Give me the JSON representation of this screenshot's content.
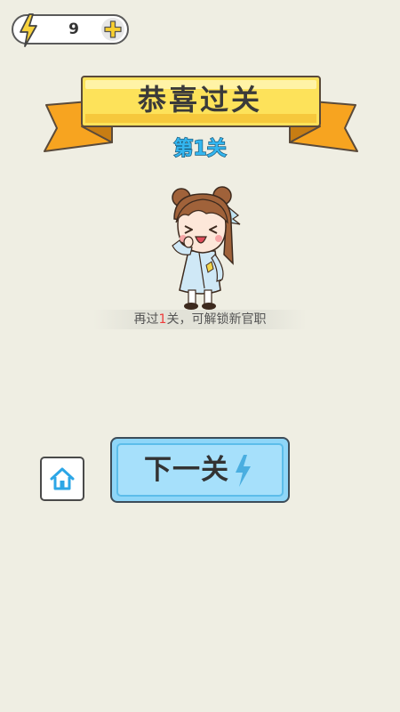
{
  "energy": {
    "count": "9"
  },
  "banner": {
    "title": "恭喜过关",
    "level": "第1关"
  },
  "hint": {
    "prefix": "再过",
    "number": "1",
    "suffix": "关，可解锁新官职"
  },
  "buttons": {
    "next_label": "下一关"
  },
  "icons": {
    "energy": "lightning-bolt-icon",
    "add": "plus-icon",
    "home": "home-icon",
    "next_bolt": "lightning-bolt-icon"
  },
  "colors": {
    "background": "#efeee3",
    "ribbon_yellow": "#fde25a",
    "ribbon_orange": "#f7a420",
    "level_blue": "#34b6f0",
    "button_blue": "#8ed6f8",
    "highlight_red": "#ee3b3b"
  }
}
